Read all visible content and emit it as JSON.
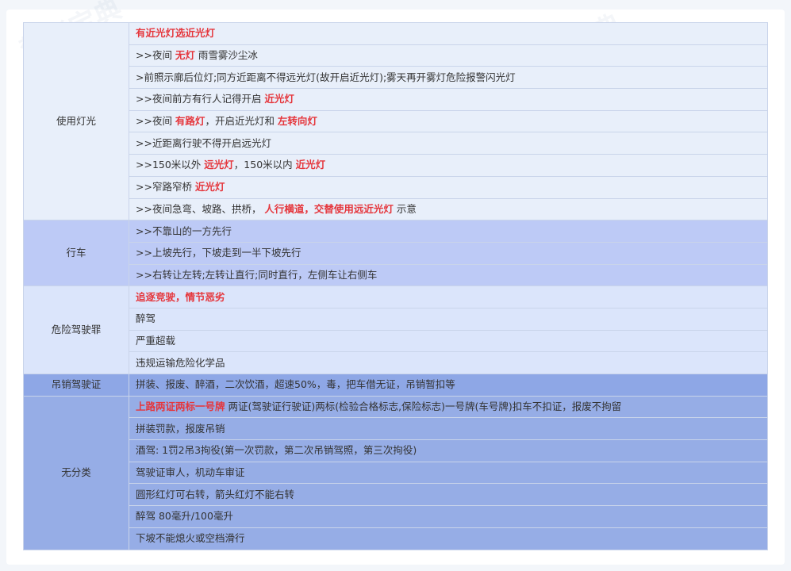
{
  "watermark": "驾考宝典",
  "groups": [
    {
      "category": "使用灯光",
      "rows": [
        {
          "spans": [
            {
              "text": "有近光灯选近光灯",
              "hl": true
            }
          ]
        },
        {
          "spans": [
            {
              "text": ">>夜间 ",
              "hl": false
            },
            {
              "text": "无灯",
              "hl": true
            },
            {
              "text": " 雨雪雾沙尘冰",
              "hl": false
            }
          ]
        },
        {
          "spans": [
            {
              "text": ">前照示廓后位灯;同方近距离不得远光灯(故开启近光灯);雾天再开雾灯危险报警闪光灯",
              "hl": false
            }
          ]
        },
        {
          "spans": [
            {
              "text": ">>夜间前方有行人记得开启 ",
              "hl": false
            },
            {
              "text": "近光灯",
              "hl": true
            }
          ]
        },
        {
          "spans": [
            {
              "text": ">>夜间 ",
              "hl": false
            },
            {
              "text": "有路灯",
              "hl": true
            },
            {
              "text": "，开启近光灯和 ",
              "hl": false
            },
            {
              "text": "左转向灯",
              "hl": true
            }
          ]
        },
        {
          "spans": [
            {
              "text": ">>近距离行驶不得开启远光灯",
              "hl": false
            }
          ]
        },
        {
          "spans": [
            {
              "text": ">>150米以外 ",
              "hl": false
            },
            {
              "text": "远光灯",
              "hl": true
            },
            {
              "text": "，150米以内 ",
              "hl": false
            },
            {
              "text": "近光灯",
              "hl": true
            }
          ]
        },
        {
          "spans": [
            {
              "text": ">>窄路窄桥 ",
              "hl": false
            },
            {
              "text": "近光灯",
              "hl": true
            }
          ]
        },
        {
          "spans": [
            {
              "text": ">>夜间急弯、坡路、拱桥， ",
              "hl": false
            },
            {
              "text": "人行横道，交替使用远近光灯",
              "hl": true
            },
            {
              "text": " 示意",
              "hl": false
            }
          ]
        }
      ]
    },
    {
      "category": "行车",
      "rows": [
        {
          "spans": [
            {
              "text": ">>不靠山的一方先行",
              "hl": false
            }
          ]
        },
        {
          "spans": [
            {
              "text": ">>上坡先行，下坡走到一半下坡先行",
              "hl": false
            }
          ]
        },
        {
          "spans": [
            {
              "text": ">>右转让左转;左转让直行;同时直行，左侧车让右侧车",
              "hl": false
            }
          ]
        }
      ]
    },
    {
      "category": "危险驾驶罪",
      "rows": [
        {
          "spans": [
            {
              "text": "追逐竞驶，情节恶劣",
              "hl": true
            }
          ]
        },
        {
          "spans": [
            {
              "text": "醉驾",
              "hl": false
            }
          ]
        },
        {
          "spans": [
            {
              "text": "严重超载",
              "hl": false
            }
          ]
        },
        {
          "spans": [
            {
              "text": "违规运输危险化学品",
              "hl": false
            }
          ]
        }
      ]
    },
    {
      "category": "吊销驾驶证",
      "rows": [
        {
          "spans": [
            {
              "text": "拼装、报废、醉酒，二次饮酒，超速50%，毒，把车借无证，吊销暂扣等",
              "hl": false
            }
          ]
        }
      ]
    },
    {
      "category": "无分类",
      "rows": [
        {
          "spans": [
            {
              "text": "上路两证两标一号牌",
              "hl": true
            },
            {
              "text": " 两证(驾驶证行驶证)两标(检验合格标志,保险标志)一号牌(车号牌)扣车不扣证，报废不拘留",
              "hl": false
            }
          ]
        },
        {
          "spans": [
            {
              "text": "拼装罚款，报废吊销",
              "hl": false
            }
          ]
        },
        {
          "spans": [
            {
              "text": "酒驾: 1罚2吊3拘役(第一次罚款，第二次吊销驾照，第三次拘役)",
              "hl": false
            }
          ]
        },
        {
          "spans": [
            {
              "text": "驾驶证审人，机动车审证",
              "hl": false
            }
          ]
        },
        {
          "spans": [
            {
              "text": "圆形红灯可右转，箭头红灯不能右转",
              "hl": false
            }
          ]
        },
        {
          "spans": [
            {
              "text": "醉驾 80毫升/100毫升",
              "hl": false
            }
          ]
        },
        {
          "spans": [
            {
              "text": "下坡不能熄火或空档滑行",
              "hl": false
            }
          ]
        }
      ]
    }
  ]
}
